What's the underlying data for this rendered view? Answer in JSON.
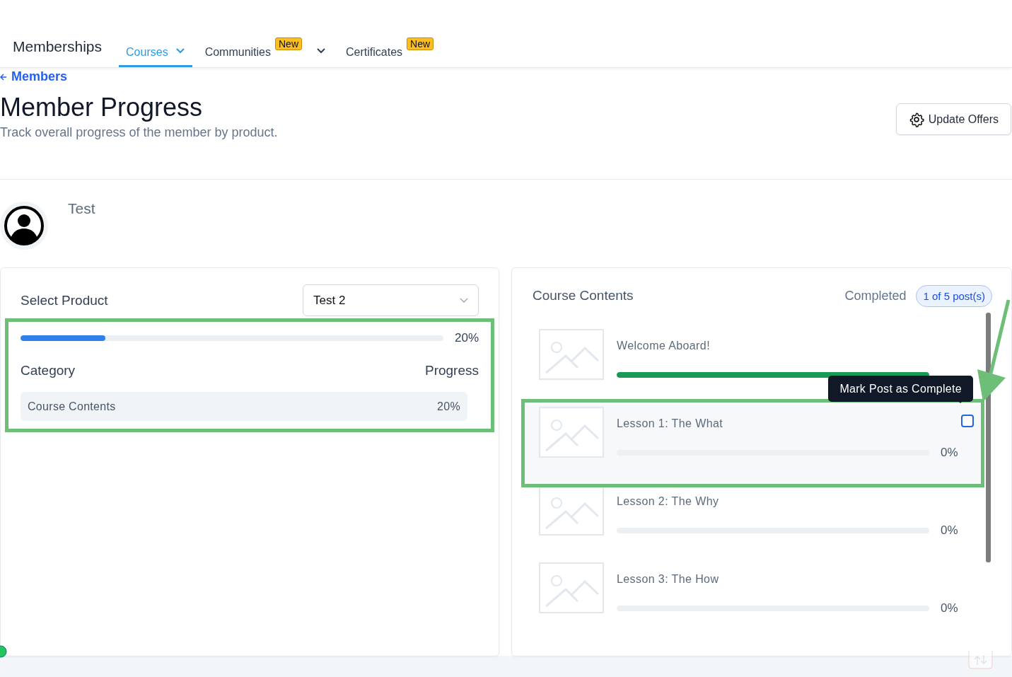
{
  "nav": {
    "brand": "Memberships",
    "tabs": [
      {
        "label": "Courses",
        "selected": true,
        "has_menu": true
      },
      {
        "label": "Communities",
        "selected": false,
        "badge": "New",
        "has_menu": true
      },
      {
        "label": "Certificates",
        "selected": false,
        "badge": "New",
        "has_menu": false
      }
    ]
  },
  "back_link": "Members",
  "header": {
    "title": "Member Progress",
    "subtitle": "Track overall progress of the member by product.",
    "button": "Update Offers"
  },
  "member": {
    "name": "Test"
  },
  "product": {
    "label": "Select Product",
    "selected_value": "Test 2",
    "level": 0.2,
    "reading": "20%",
    "highlighted": true,
    "columns": [
      "Category",
      "Progress"
    ],
    "rows": [
      {
        "category": "Course Contents",
        "progress": "20%"
      }
    ]
  },
  "course": {
    "title": "Course Contents",
    "completed_label": "Completed",
    "completed_count": "1 of 5 post(s)",
    "lessons": [
      {
        "title": "Welcome Aboard!",
        "level": 1,
        "hovered": false,
        "highlighted": false
      },
      {
        "title": "Lesson 1: The What",
        "level": 0,
        "reading": "0%",
        "hovered": true,
        "checked": false,
        "highlighted": true,
        "tooltip": "Mark Post as Complete"
      },
      {
        "title": "Lesson 2: The Why",
        "level": 0,
        "reading": "0%",
        "hovered": false,
        "highlighted": false
      },
      {
        "title": "Lesson 3: The How",
        "level": 0,
        "reading": "0%",
        "hovered": false,
        "highlighted": false
      }
    ]
  }
}
